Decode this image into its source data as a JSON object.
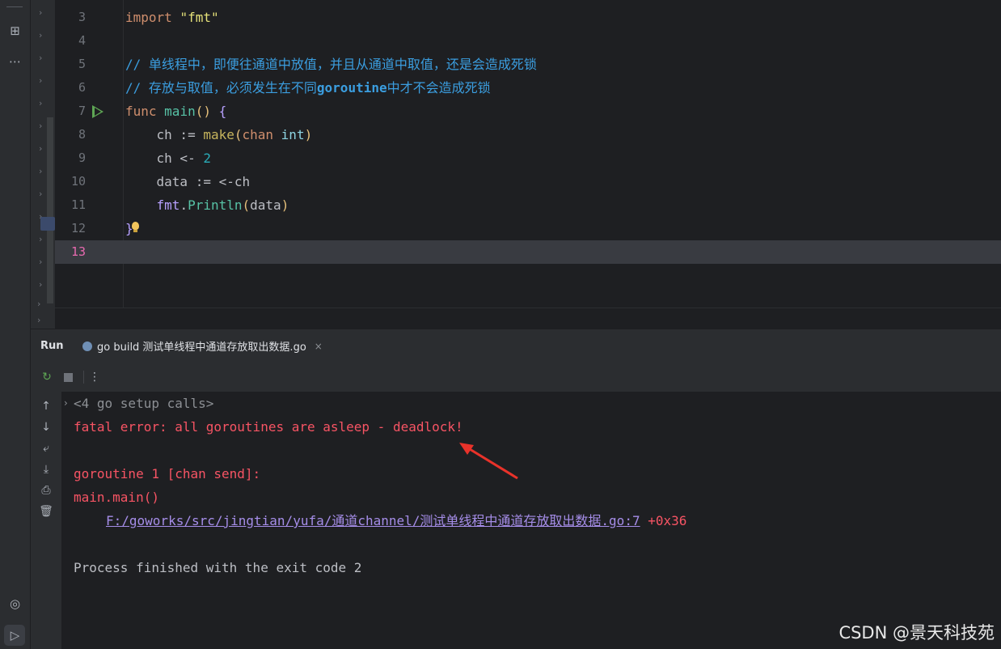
{
  "editor": {
    "lines": [
      {
        "num": "3",
        "segments": [
          {
            "t": "import ",
            "c": "kw"
          },
          {
            "t": "\"fmt\"",
            "c": "str"
          }
        ]
      },
      {
        "num": "4",
        "segments": []
      },
      {
        "num": "5",
        "segments": [
          {
            "t": "// 单线程中，即便往通道中放值，并且从通道中取值，还是会造成死锁",
            "c": "cmt"
          }
        ]
      },
      {
        "num": "6",
        "segments": [
          {
            "t": "// 存放与取值，必须发生在不同",
            "c": "cmt"
          },
          {
            "t": "goroutine",
            "c": "cmtb"
          },
          {
            "t": "中才不会造成死锁",
            "c": "cmt"
          }
        ]
      },
      {
        "num": "7",
        "segments": [
          {
            "t": "func ",
            "c": "kw"
          },
          {
            "t": "main",
            "c": "fn-main"
          },
          {
            "t": "() ",
            "c": "brk"
          },
          {
            "t": "{",
            "c": "fn2"
          }
        ]
      },
      {
        "num": "8",
        "segments": [
          {
            "t": "    ch := ",
            "c": "pkg"
          },
          {
            "t": "make",
            "c": "fn-make"
          },
          {
            "t": "(",
            "c": "brk"
          },
          {
            "t": "chan ",
            "c": "kw"
          },
          {
            "t": "int",
            "c": "typ"
          },
          {
            "t": ")",
            "c": "brk"
          }
        ]
      },
      {
        "num": "9",
        "segments": [
          {
            "t": "    ch <- ",
            "c": "pkg"
          },
          {
            "t": "2",
            "c": "num"
          }
        ]
      },
      {
        "num": "10",
        "segments": [
          {
            "t": "    data := <-ch",
            "c": "pkg"
          }
        ]
      },
      {
        "num": "11",
        "segments": [
          {
            "t": "    ",
            "c": "pkg"
          },
          {
            "t": "fmt",
            "c": "fn2"
          },
          {
            "t": ".",
            "c": "pkg"
          },
          {
            "t": "Println",
            "c": "fn-println"
          },
          {
            "t": "(",
            "c": "brk"
          },
          {
            "t": "data",
            "c": "pkg"
          },
          {
            "t": ")",
            "c": "brk"
          }
        ]
      },
      {
        "num": "12",
        "segments": [
          {
            "t": "}",
            "c": "fn2"
          }
        ]
      },
      {
        "num": "13",
        "segments": []
      }
    ],
    "current_line": "13"
  },
  "run": {
    "title": "Run",
    "tab_label": "go build 测试单线程中通道存放取出数据.go",
    "tab_close": "×"
  },
  "console": {
    "setup_calls": "<4 go setup calls>",
    "fatal": "fatal error: all goroutines are asleep - deadlock!",
    "goroutine": "goroutine 1 [chan send]:",
    "main": "main.main()",
    "link": "F:/goworks/src/jingtian/yufa/通道channel/测试单线程中通道存放取出数据.go:7",
    "offset": " +0x36",
    "exit": "Process finished with the exit code 2"
  },
  "watermark": "CSDN @景天科技苑",
  "colors": {
    "accent": "#3574f0",
    "error": "#f75464",
    "run_green": "#5ea654",
    "arrow": "#e8322a"
  }
}
